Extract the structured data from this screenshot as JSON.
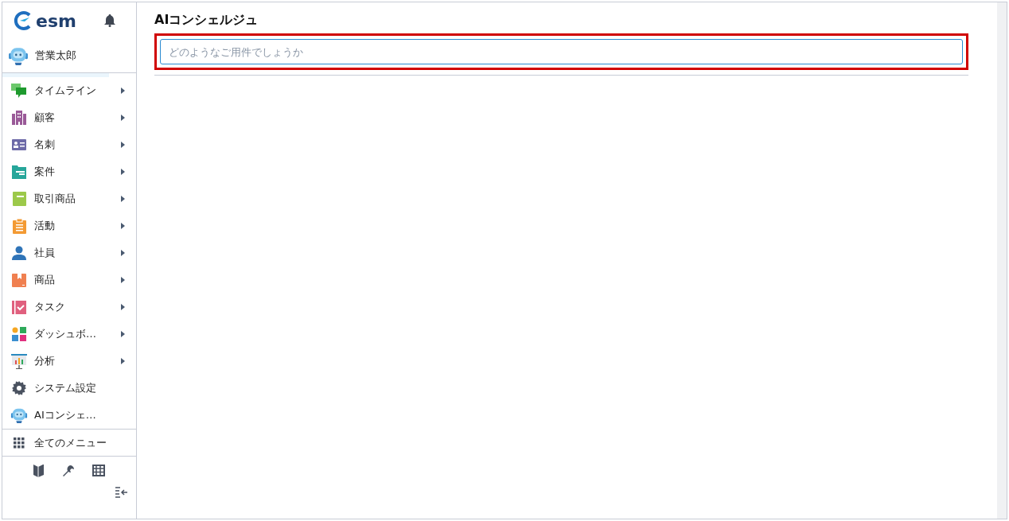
{
  "sidebar": {
    "logo": "esm",
    "user": {
      "name": "営業太郎"
    },
    "items": [
      {
        "label": "タイムライン",
        "has_submenu": true
      },
      {
        "label": "顧客",
        "has_submenu": true
      },
      {
        "label": "名刺",
        "has_submenu": true
      },
      {
        "label": "案件",
        "has_submenu": true
      },
      {
        "label": "取引商品",
        "has_submenu": true
      },
      {
        "label": "活動",
        "has_submenu": true
      },
      {
        "label": "社員",
        "has_submenu": true
      },
      {
        "label": "商品",
        "has_submenu": true
      },
      {
        "label": "タスク",
        "has_submenu": true
      },
      {
        "label": "ダッシュボ…",
        "has_submenu": true
      },
      {
        "label": "分析",
        "has_submenu": true
      },
      {
        "label": "システム設定",
        "has_submenu": false
      },
      {
        "label": "AIコンシェ…",
        "has_submenu": false
      }
    ],
    "all_menu": "全てのメニュー"
  },
  "main": {
    "title": "AIコンシェルジュ",
    "query": {
      "placeholder": "どのようなご用件でしょうか",
      "highlighted": true
    }
  }
}
